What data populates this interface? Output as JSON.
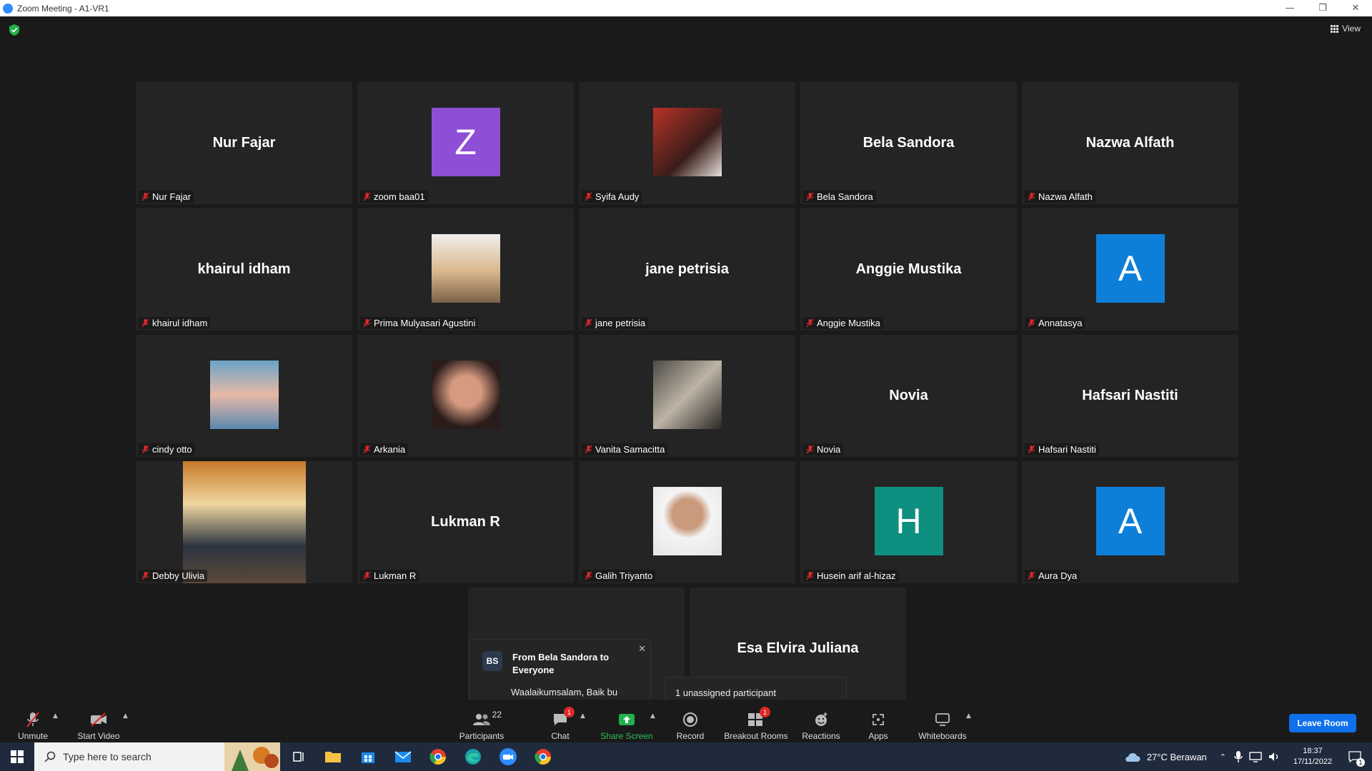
{
  "window": {
    "title": "Zoom Meeting - A1-VR1"
  },
  "view_label": "View",
  "tiles": [
    {
      "display": "name",
      "big": "Nur Fajar",
      "label": "Nur Fajar"
    },
    {
      "display": "letter",
      "letter": "Z",
      "color": "#8e4fd6",
      "label": "zoom baa01"
    },
    {
      "display": "photo",
      "label": "Syifa Audy"
    },
    {
      "display": "name",
      "big": "Bela Sandora",
      "label": "Bela Sandora"
    },
    {
      "display": "name",
      "big": "Nazwa Alfath",
      "label": "Nazwa Alfath"
    },
    {
      "display": "name",
      "big": "khairul idham",
      "label": "khairul idham"
    },
    {
      "display": "photo",
      "label": "Prima Mulyasari Agustini"
    },
    {
      "display": "name",
      "big": "jane petrisia",
      "label": "jane petrisia"
    },
    {
      "display": "name",
      "big": "Anggie Mustika",
      "label": "Anggie Mustika"
    },
    {
      "display": "letter",
      "letter": "A",
      "color": "#0e7fd9",
      "label": "Annatasya"
    },
    {
      "display": "photo",
      "label": "cindy otto"
    },
    {
      "display": "photo",
      "label": "Arkania"
    },
    {
      "display": "photo",
      "label": "Vanita Samacitta"
    },
    {
      "display": "name",
      "big": "Novia",
      "label": "Novia"
    },
    {
      "display": "name",
      "big": "Hafsari Nastiti",
      "label": "Hafsari Nastiti"
    },
    {
      "display": "photo",
      "label": "Debby Ulivia"
    },
    {
      "display": "name",
      "big": "Lukman R",
      "label": "Lukman R"
    },
    {
      "display": "photo",
      "label": "Galih Triyanto"
    },
    {
      "display": "letter",
      "letter": "H",
      "color": "#0f8f7f",
      "label": "Husein arif al-hizaz"
    },
    {
      "display": "letter",
      "letter": "A",
      "color": "#0e7fd9",
      "label": "Aura Dya"
    },
    {
      "display": "empty"
    },
    {
      "display": "name",
      "big": "Esa Elvira Juliana"
    }
  ],
  "chat_popup": {
    "initials": "BS",
    "from": "From Bela Sandora to Everyone",
    "message": "Waalaikumsalam, Baik bu"
  },
  "unassigned": "1 unassigned participant",
  "toolbar": {
    "unmute": "Unmute",
    "start_video": "Start Video",
    "participants": "Participants",
    "participants_count": "22",
    "chat": "Chat",
    "chat_badge": "1",
    "share_screen": "Share Screen",
    "record": "Record",
    "breakout_rooms": "Breakout Rooms",
    "breakout_badge": "1",
    "reactions": "Reactions",
    "apps": "Apps",
    "whiteboards": "Whiteboards",
    "leave": "Leave Room"
  },
  "taskbar": {
    "search_placeholder": "Type here to search",
    "weather": "27°C  Berawan",
    "time": "18:37",
    "date": "17/11/2022",
    "notification_count": "1"
  }
}
